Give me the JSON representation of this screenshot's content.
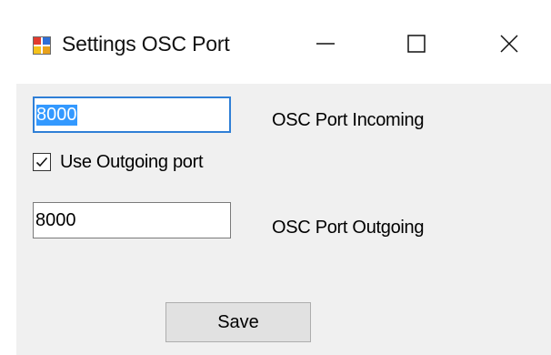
{
  "window": {
    "title": "Settings OSC Port",
    "icon": "windows-form-icon",
    "controls": {
      "minimize": "minimize-icon",
      "maximize": "maximize-icon",
      "close": "close-icon"
    }
  },
  "form": {
    "incoming": {
      "value": "8000",
      "label": "OSC Port Incoming"
    },
    "use_outgoing": {
      "label": "Use Outgoing port",
      "checked": true
    },
    "outgoing": {
      "value": "8000",
      "label": "OSC Port Outgoing"
    },
    "save_label": "Save"
  },
  "colors": {
    "client_background": "#f0f0f0",
    "focus_border": "#2f7fd6",
    "selection": "#3399ff",
    "button_face": "#e1e1e1"
  }
}
